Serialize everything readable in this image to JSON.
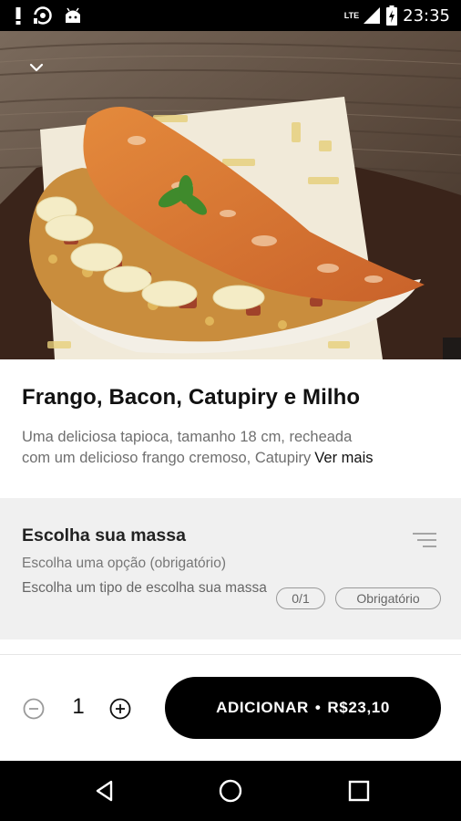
{
  "status_bar": {
    "time": "23:35",
    "network": "LTE",
    "left_icons": [
      "alert-icon",
      "sync-icon",
      "android-icon"
    ],
    "right_icons": [
      "signal-icon",
      "battery-icon"
    ]
  },
  "hero": {
    "image_alt": "Tapioca de frango com bacon, catupiry e milho",
    "collapse_icon": "chevron-down-icon"
  },
  "product": {
    "title": "Frango, Bacon, Catupiry e Milho",
    "description_line1": "Uma deliciosa tapioca, tamanho 18 cm, recheada",
    "description_line2": "com um delicioso frango cremoso, Catupiry",
    "see_more": "Ver mais"
  },
  "choice_group": {
    "title": "Escolha sua massa",
    "requirement": "Escolha uma opção (obrigatório)",
    "description": "Escolha um tipo de escolha sua massa",
    "count": "0/1",
    "badge": "Obrigatório",
    "icon": "filter-icon"
  },
  "cart": {
    "quantity": "1",
    "add_label": "ADICIONAR",
    "separator": "•",
    "price": "R$23,10"
  },
  "colors": {
    "accent": "#000000",
    "section_bg": "#f0f0f0",
    "muted_text": "#6f6f6f"
  },
  "nav_bar": {
    "icons": [
      "back-icon",
      "home-icon",
      "recents-icon"
    ]
  }
}
